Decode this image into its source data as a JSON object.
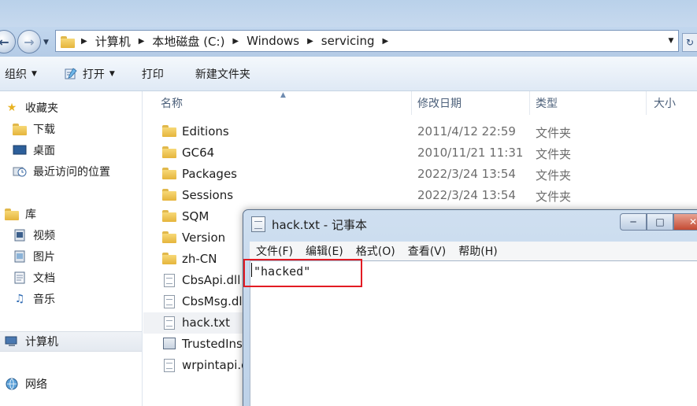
{
  "explorer": {
    "address": {
      "crumbs": [
        "计算机",
        "本地磁盘 (C:)",
        "Windows",
        "servicing"
      ]
    },
    "toolbar": {
      "organize": "组织",
      "open": "打开",
      "print": "打印",
      "new_folder": "新建文件夹"
    },
    "sidebar": {
      "favorites": "收藏夹",
      "downloads": "下载",
      "desktop": "桌面",
      "recent": "最近访问的位置",
      "libraries": "库",
      "videos": "视频",
      "pictures": "图片",
      "documents": "文档",
      "music": "音乐",
      "computer": "计算机",
      "network": "网络"
    },
    "columns": {
      "name": "名称",
      "date": "修改日期",
      "type": "类型",
      "size": "大小"
    },
    "files": [
      {
        "name": "Editions",
        "date": "2011/4/12 22:59",
        "type": "文件夹",
        "icon": "folder-icon"
      },
      {
        "name": "GC64",
        "date": "2010/11/21 11:31",
        "type": "文件夹",
        "icon": "folder-icon"
      },
      {
        "name": "Packages",
        "date": "2022/3/24 13:54",
        "type": "文件夹",
        "icon": "folder-icon"
      },
      {
        "name": "Sessions",
        "date": "2022/3/24 13:54",
        "type": "文件夹",
        "icon": "folder-icon"
      },
      {
        "name": "SQM",
        "date": "",
        "type": "",
        "icon": "folder-icon"
      },
      {
        "name": "Version",
        "date": "",
        "type": "",
        "icon": "folder-icon"
      },
      {
        "name": "zh-CN",
        "date": "",
        "type": "",
        "icon": "folder-icon"
      },
      {
        "name": "CbsApi.dll",
        "date": "",
        "type": "",
        "icon": "dll-file-icon"
      },
      {
        "name": "CbsMsg.dll",
        "date": "",
        "type": "",
        "icon": "dll-file-icon"
      },
      {
        "name": "hack.txt",
        "date": "",
        "type": "",
        "icon": "text-file-icon"
      },
      {
        "name": "TrustedInst",
        "date": "",
        "type": "",
        "icon": "exe-file-icon"
      },
      {
        "name": "wrpintapi.d",
        "date": "",
        "type": "",
        "icon": "dll-file-icon"
      }
    ]
  },
  "notepad": {
    "title": "hack.txt - 记事本",
    "menus": [
      "文件(F)",
      "编辑(E)",
      "格式(O)",
      "查看(V)",
      "帮助(H)"
    ],
    "content": "\"hacked\""
  },
  "colors": {
    "highlight_border": "#e31b23",
    "title_bar": "#bcd1e8",
    "close_button": "#c44a33"
  }
}
